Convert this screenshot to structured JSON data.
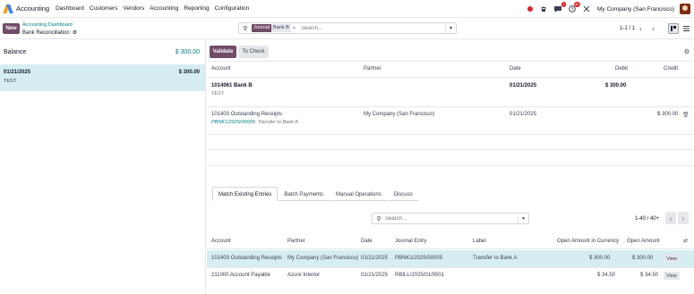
{
  "navbar": {
    "app": "Accounting",
    "menu": [
      "Dashboard",
      "Customers",
      "Vendors",
      "Accounting",
      "Reporting",
      "Configuration"
    ],
    "activity_badge": "7",
    "messages_badge": "40",
    "company": "My Company (San Francisco)"
  },
  "control": {
    "new_label": "New",
    "breadcrumb_parent": "Accounting Dashboard",
    "breadcrumb_current": "Bank Reconciliation",
    "facet_key": "Journal",
    "facet_value": "Bank B",
    "facet_remove": "×",
    "search_placeholder": "Search...",
    "pager": "1-1 / 1"
  },
  "left": {
    "balance_label": "Balance",
    "balance_value": "$ 300.00",
    "statement": {
      "date": "01/21/2025",
      "amount": "$ 300.00",
      "label": "TEST"
    }
  },
  "right": {
    "validate_label": "Validate",
    "tocheck_label": "To Check",
    "columns": {
      "account": "Account",
      "partner": "Partner",
      "date": "Date",
      "debit": "Debit",
      "credit": "Credit"
    },
    "line1": {
      "account": "1014061 Bank B",
      "label": "TEST",
      "date": "01/21/2025",
      "debit": "$ 300.00"
    },
    "line2": {
      "account": "101403 Outstanding Receipts",
      "ref": "PBNK1/2025/00005",
      "label": ": Transfer to Bank A",
      "partner": "My Company (San Francisco)",
      "date": "01/21/2025",
      "credit": "$ 300.00"
    }
  },
  "tabs": [
    "Match Existing Entries",
    "Batch Payments",
    "Manual Operations",
    "Discuss"
  ],
  "match": {
    "search_placeholder": "Search...",
    "pager": "1-40 / 40+",
    "columns": {
      "account": "Account",
      "partner": "Partner",
      "date": "Date",
      "journal_entry": "Journal Entry",
      "label": "Label",
      "open_currency": "Open Amount in Currency",
      "open_amount": "Open Amount"
    },
    "rows": [
      {
        "account": "101403 Outstanding Receipts",
        "partner": "My Company (San Francisco)",
        "date": "01/21/2025",
        "journal_entry": "PBNK1/2025/00005",
        "label": "Transfer to Bank A",
        "open_currency": "$ 300.00",
        "open_amount": "$ 300.00",
        "action": "View"
      },
      {
        "account": "211000 Account Payable",
        "partner": "Azure Interior",
        "date": "01/21/2025",
        "journal_entry": "RBILL/2025/01/0001",
        "label": "",
        "open_currency": "$ 34.50",
        "open_amount": "$ 34.50",
        "action": "View"
      }
    ]
  },
  "colors": {
    "primary": "#714b67",
    "link": "#017e84",
    "highlight": "#d6eef2"
  },
  "icons": [
    "search-icon",
    "gear-icon",
    "chevron-left-icon",
    "chevron-right-icon",
    "kanban-view-icon",
    "list-view-icon",
    "trash-icon",
    "chat-icon",
    "clock-icon",
    "tools-icon"
  ]
}
